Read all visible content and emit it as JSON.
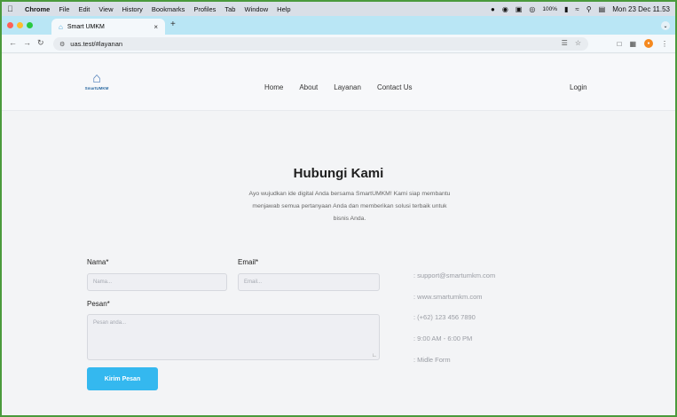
{
  "macos_menubar": {
    "app": "Chrome",
    "menus": [
      "File",
      "Edit",
      "View",
      "History",
      "Bookmarks",
      "Profiles",
      "Tab",
      "Window",
      "Help"
    ],
    "battery": "100%",
    "clock": "Mon 23 Dec 11.53"
  },
  "browser": {
    "tab_title": "Smart UMKM",
    "url": "uas.test/#layanan"
  },
  "site": {
    "brand": "SmartUMKM",
    "nav": [
      "Home",
      "About",
      "Layanan",
      "Contact Us"
    ],
    "login": "Login"
  },
  "contact": {
    "title": "Hubungi Kami",
    "intro_lines": [
      "Ayo wujudkan ide digital Anda bersama SmartUMKM! Kami siap membantu",
      "menjawab semua pertanyaan Anda dan memberikan solusi terbaik untuk",
      "bisnis Anda."
    ],
    "form": {
      "name_label": "Nama*",
      "name_placeholder": "Nama...",
      "email_label": "Email*",
      "email_placeholder": "Email...",
      "message_label": "Pesan*",
      "message_placeholder": "Pesan anda...",
      "submit": "Kirim Pesan"
    },
    "info": [
      ": support@smartumkm.com",
      ": www.smartumkm.com",
      ": (+62) 123 456 7890",
      ": 9:00 AM - 6:00 PM",
      ": Midle Form"
    ]
  },
  "colors": {
    "accent": "#34b8ef",
    "tabstrip": "#b9e6f5",
    "frame": "#4a9a3c"
  }
}
